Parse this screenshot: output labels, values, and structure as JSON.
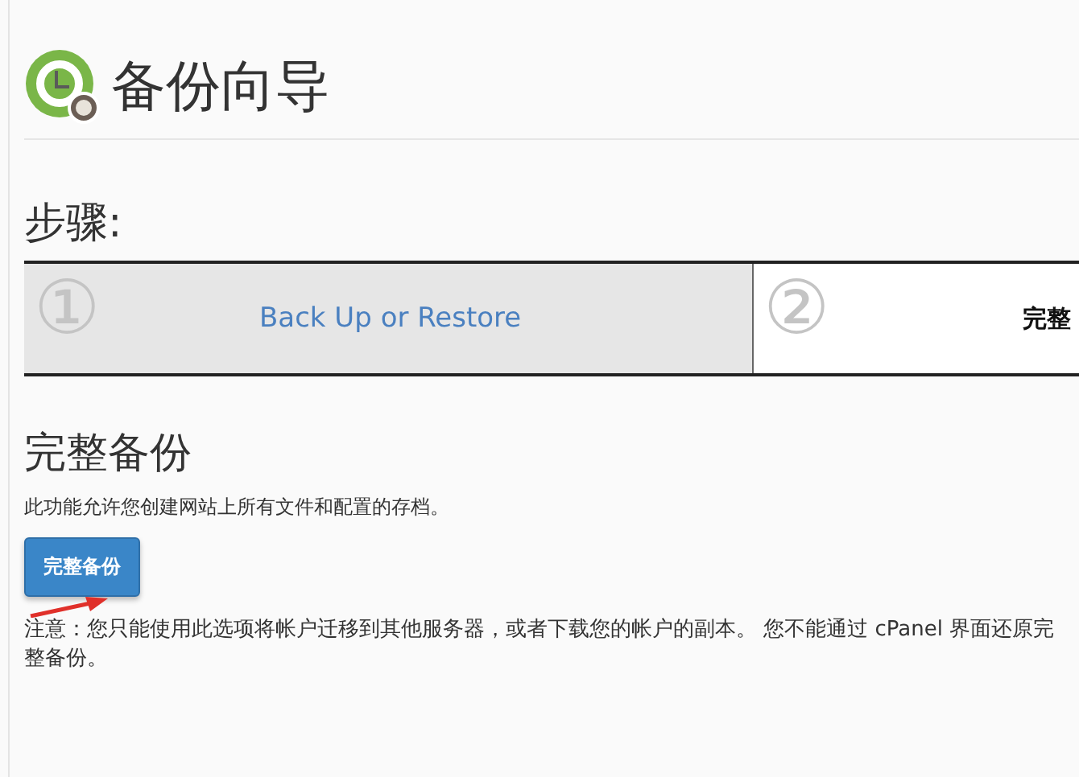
{
  "page": {
    "title": "备份向导"
  },
  "steps_heading": "步骤:",
  "steps": [
    {
      "number": "①",
      "label": "Back Up or Restore",
      "selected": false
    },
    {
      "number": "②",
      "label": "完整",
      "selected": true
    }
  ],
  "section": {
    "heading": "完整备份",
    "description": "此功能允许您创建网站上所有文件和配置的存档。",
    "button": "完整备份",
    "note": "注意：您只能使用此选项将帐户迁移到其他服务器，或者下载您的帐户的副本。 您不能通过 cPanel 界面还原完整备份。"
  }
}
